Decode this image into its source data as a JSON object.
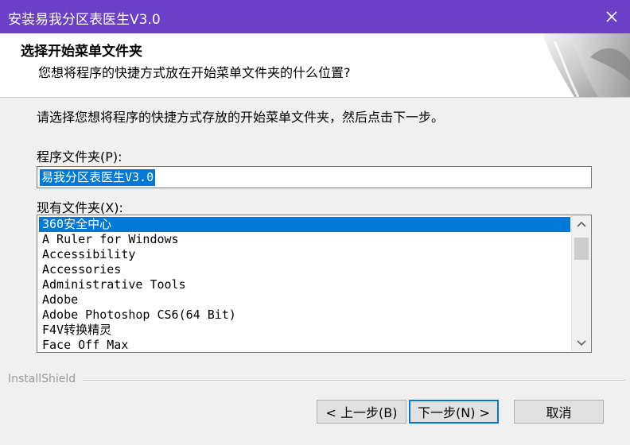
{
  "window": {
    "title": "安装易我分区表医生V3.0"
  },
  "header": {
    "title": "选择开始菜单文件夹",
    "subtitle": "您想将程序的快捷方式放在开始菜单文件夹的什么位置?"
  },
  "body": {
    "instruction": "请选择您想将程序的快捷方式存放的开始菜单文件夹，然后点击下一步。",
    "program_folder_label": "程序文件夹(P):",
    "program_folder_value": "易我分区表医生V3.0",
    "existing_folders_label": "现有文件夹(X):",
    "existing_folders": [
      "360安全中心",
      "A Ruler for Windows",
      "Accessibility",
      "Accessories",
      "Administrative Tools",
      "Adobe",
      "Adobe Photoshop CS6(64 Bit)",
      "F4V转换精灵",
      "Face Off Max"
    ],
    "selected_index": 0
  },
  "footer": {
    "brand": "InstallShield",
    "back_label": "< 上一步(B)",
    "next_label": "下一步(N) >",
    "cancel_label": "取消"
  },
  "colors": {
    "titlebar": "#6b3fc8",
    "selection": "#0078d7"
  }
}
